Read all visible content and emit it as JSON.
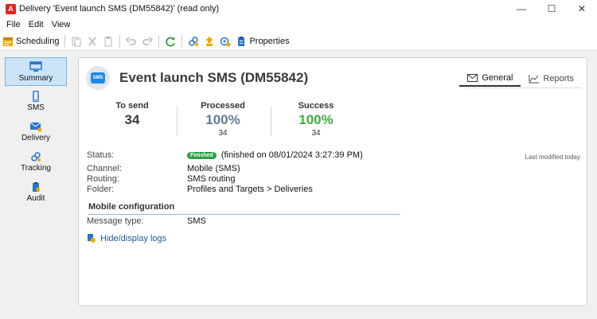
{
  "window": {
    "app_icon": "A",
    "title": "Delivery 'Event launch SMS (DM55842)' (read only)",
    "controls": {
      "minimize": "—",
      "maximize": "☐",
      "close": "✕"
    }
  },
  "menu": [
    "File",
    "Edit",
    "View"
  ],
  "toolbar": {
    "scheduling_label": "Scheduling",
    "properties_label": "Properties",
    "icons": [
      "calendar-icon",
      "copy-icon",
      "cut-icon",
      "paste-icon",
      "undo-icon",
      "redo-icon",
      "refresh-icon",
      "link-icon",
      "upload-icon",
      "settings-icon",
      "properties-icon"
    ]
  },
  "sidebar": {
    "items": [
      {
        "label": "Summary",
        "icon": "monitor-icon",
        "active": true
      },
      {
        "label": "SMS",
        "icon": "phone-icon",
        "active": false
      },
      {
        "label": "Delivery",
        "icon": "envelope-icon",
        "active": false
      },
      {
        "label": "Tracking",
        "icon": "link-icon",
        "active": false
      },
      {
        "label": "Audit",
        "icon": "audit-icon",
        "active": false
      }
    ]
  },
  "header": {
    "badge_text": "SMS",
    "title": "Event launch SMS (DM55842)",
    "tabs": [
      {
        "label": "General",
        "icon": "envelope-icon",
        "active": true
      },
      {
        "label": "Reports",
        "icon": "chart-icon",
        "active": false
      }
    ]
  },
  "kpis": {
    "to_send": {
      "label": "To send",
      "value": "34"
    },
    "processed": {
      "label": "Processed",
      "value": "100%",
      "count": "34"
    },
    "success": {
      "label": "Success",
      "value": "100%",
      "count": "34"
    }
  },
  "details": {
    "status_label": "Status:",
    "status_badge": "Finished",
    "status_text": "(finished on 08/01/2024 3:27:39 PM)",
    "last_modified": "Last modified today",
    "channel_label": "Channel:",
    "channel_value": "Mobile (SMS)",
    "routing_label": "Routing:",
    "routing_value": "SMS routing",
    "folder_label": "Folder:",
    "folder_value": "Profiles and Targets > Deliveries"
  },
  "mobile_config": {
    "title": "Mobile configuration",
    "message_type_label": "Message type:",
    "message_type_value": "SMS"
  },
  "logs_link": "Hide/display logs",
  "colors": {
    "accent_blue": "#1e88e5",
    "success_green": "#3eaa3e",
    "processed_blue": "#5f7a99",
    "brand_red": "#e1251b"
  }
}
